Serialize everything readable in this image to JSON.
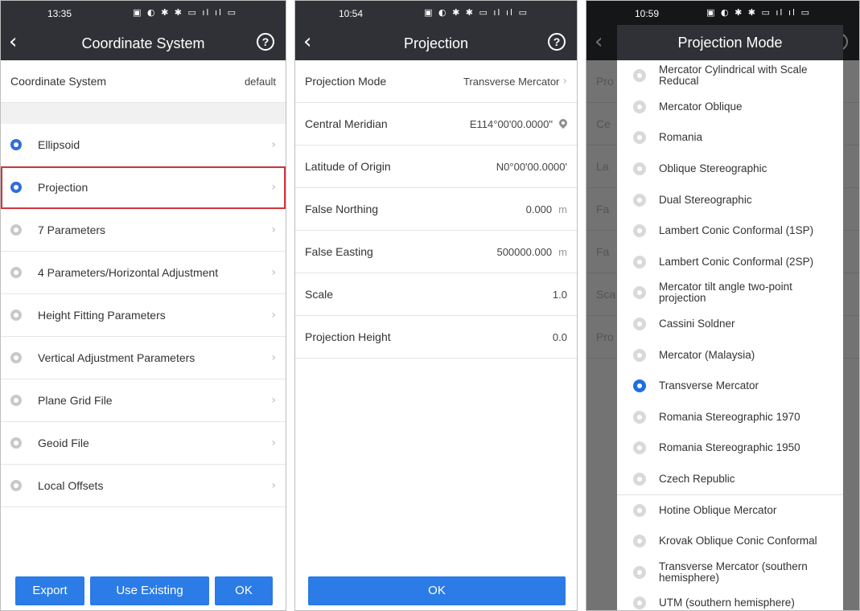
{
  "screen1": {
    "status_time": "13:35",
    "status_icons": "▣ ◐ ✱ ✱ ▭ ıl ıl ▭",
    "title": "Coordinate System",
    "coord_row": {
      "label": "Coordinate System",
      "value": "default"
    },
    "items": [
      {
        "label": "Ellipsoid",
        "icon": "gear-icon-blue"
      },
      {
        "label": "Projection",
        "icon": "gear-icon-blue"
      },
      {
        "label": "7 Parameters",
        "icon": "gear-icon-gray"
      },
      {
        "label": "4 Parameters/Horizontal Adjustment",
        "icon": "gear-icon-gray"
      },
      {
        "label": "Height Fitting Parameters",
        "icon": "gear-icon-gray"
      },
      {
        "label": "Vertical Adjustment Parameters",
        "icon": "gear-icon-gray"
      },
      {
        "label": "Plane Grid File",
        "icon": "gear-icon-gray"
      },
      {
        "label": "Geoid File",
        "icon": "gear-icon-gray"
      },
      {
        "label": "Local Offsets",
        "icon": "gear-icon-gray"
      }
    ],
    "buttons": {
      "export": "Export",
      "use_existing": "Use Existing",
      "ok": "OK"
    }
  },
  "screen2": {
    "status_time": "10:54",
    "status_icons": "▣ ◐ ✱ ✱ ▭ ıl ıl ▭",
    "title": "Projection",
    "rows": [
      {
        "label": "Projection Mode",
        "value": "Transverse Mercator"
      },
      {
        "label": "Central Meridian",
        "value": "E114°00'00.0000\""
      },
      {
        "label": "Latitude of Origin",
        "value": "N0°00'00.0000'"
      },
      {
        "label": "False Northing",
        "value": "0.000",
        "unit": "m"
      },
      {
        "label": "False Easting",
        "value": "500000.000",
        "unit": "m"
      },
      {
        "label": "Scale",
        "value": "1.0"
      },
      {
        "label": "Projection Height",
        "value": "0.0"
      }
    ],
    "ok": "OK"
  },
  "screen3": {
    "status_time": "10:59",
    "status_icons": "▣ ◐ ✱ ✱ ▭ ıl ıl ▭",
    "dialog_title": "Projection Mode",
    "bg_rows": [
      "Pro",
      "Ce",
      "La",
      "Fa",
      "Fa",
      "Sca",
      "Pro"
    ],
    "options": [
      "Mercator Cylindrical with Scale Reducal",
      "Mercator Oblique",
      "Romania",
      "Oblique Stereographic",
      "Dual Stereographic",
      "Lambert Conic Conformal (1SP)",
      "Lambert Conic Conformal (2SP)",
      "Mercator tilt angle two-point projection",
      "Cassini Soldner",
      "Mercator  (Malaysia)",
      "Transverse Mercator",
      "Romania Stereographic 1970",
      "Romania Stereographic 1950",
      "Czech Republic",
      "Hotine Oblique Mercator",
      "Krovak Oblique Conic Conformal",
      "Transverse Mercator (southern hemisphere)",
      "UTM (southern hemisphere)"
    ],
    "selected": "Transverse Mercator"
  },
  "colors": {
    "accent": "#2b7ce6",
    "header": "#2f3136",
    "highlight": "#d2363b"
  }
}
